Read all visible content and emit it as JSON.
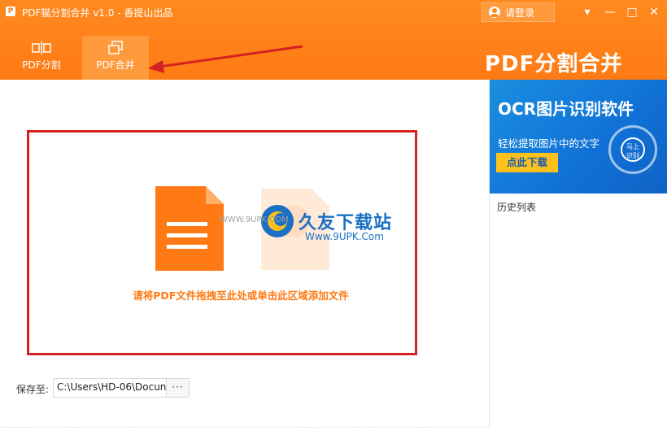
{
  "window": {
    "title": "PDF猫分割合并 v1.0 - 香提山出品",
    "logo_glyph": "P",
    "login_label": "请登录",
    "controls": {
      "menu": "▾",
      "minimize": "—",
      "maximize": "□",
      "close": "✕"
    }
  },
  "tabs": [
    {
      "label": "PDF分割",
      "icon": "split-icon"
    },
    {
      "label": "PDF合并",
      "icon": "merge-icon",
      "active": true
    }
  ],
  "brand_title": "PDF分割合并",
  "drop_zone": {
    "hint": "请将PDF文件拖拽至此处或单击此区域添加文件"
  },
  "watermark": {
    "name": "久友下载站",
    "url": "Www.9UPK.Com",
    "small": "WWW.9UPK.COM"
  },
  "save": {
    "label": "保存至:",
    "path": "C:\\Users\\HD-06\\Docun",
    "browse": "···"
  },
  "ad": {
    "title": "OCR图片识别软件",
    "subtitle": "轻松提取图片中的文字",
    "button": "点此下载",
    "badge": "马上\n识别"
  },
  "history_title": "历史列表",
  "colors": {
    "accent": "#ff7a14",
    "annotation": "#d42121",
    "ad_blue": "#1171d6"
  }
}
